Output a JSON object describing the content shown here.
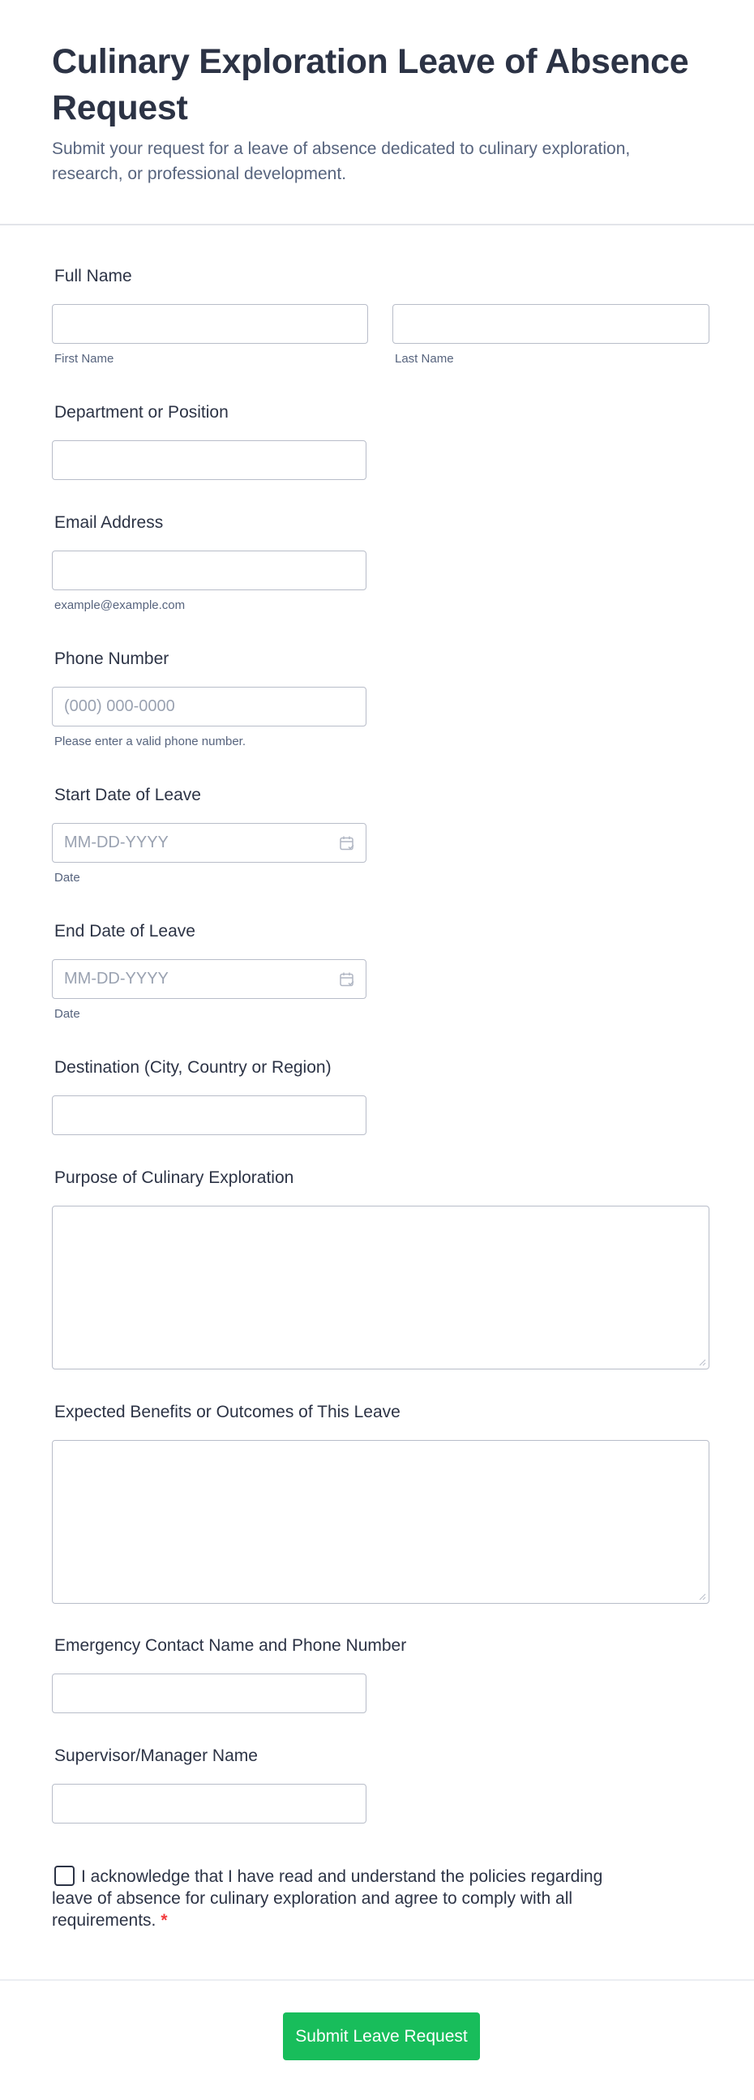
{
  "form": {
    "title": "Culinary Exploration Leave of Absence Request",
    "subtitle": "Submit your request for a leave of absence dedicated to culinary exploration, research, or professional development."
  },
  "fields": {
    "full_name": {
      "label": "Full Name",
      "first_sublabel": "First Name",
      "last_sublabel": "Last Name",
      "first_value": "",
      "last_value": ""
    },
    "department": {
      "label": "Department or Position",
      "value": ""
    },
    "email": {
      "label": "Email Address",
      "value": "",
      "sublabel": "example@example.com"
    },
    "phone": {
      "label": "Phone Number",
      "value": "",
      "placeholder": "(000) 000-0000",
      "sublabel": "Please enter a valid phone number."
    },
    "start_date": {
      "label": "Start Date of Leave",
      "placeholder": "MM-DD-YYYY",
      "sublabel": "Date",
      "icon": "calendar-icon"
    },
    "end_date": {
      "label": "End Date of Leave",
      "placeholder": "MM-DD-YYYY",
      "sublabel": "Date",
      "icon": "calendar-icon"
    },
    "destination": {
      "label": "Destination (City, Country or Region)",
      "value": ""
    },
    "purpose": {
      "label": "Purpose of Culinary Exploration",
      "value": ""
    },
    "benefits": {
      "label": "Expected Benefits or Outcomes of This Leave",
      "value": ""
    },
    "emergency_contact": {
      "label": "Emergency Contact Name and Phone Number",
      "value": ""
    },
    "supervisor": {
      "label": "Supervisor/Manager Name",
      "value": ""
    }
  },
  "acknowledgement": {
    "text": "I acknowledge that I have read and understand the policies regarding leave of absence for culinary exploration and agree to comply with all requirements.",
    "required_mark": "*",
    "checked": false
  },
  "submit": {
    "label": "Submit Leave Request"
  },
  "colors": {
    "text": "#2c3345",
    "subtext": "#57647e",
    "placeholder": "#9aa2b1",
    "border": "#b8bdc9",
    "submit_bg": "#18bd5b",
    "required": "#f23a3c"
  }
}
